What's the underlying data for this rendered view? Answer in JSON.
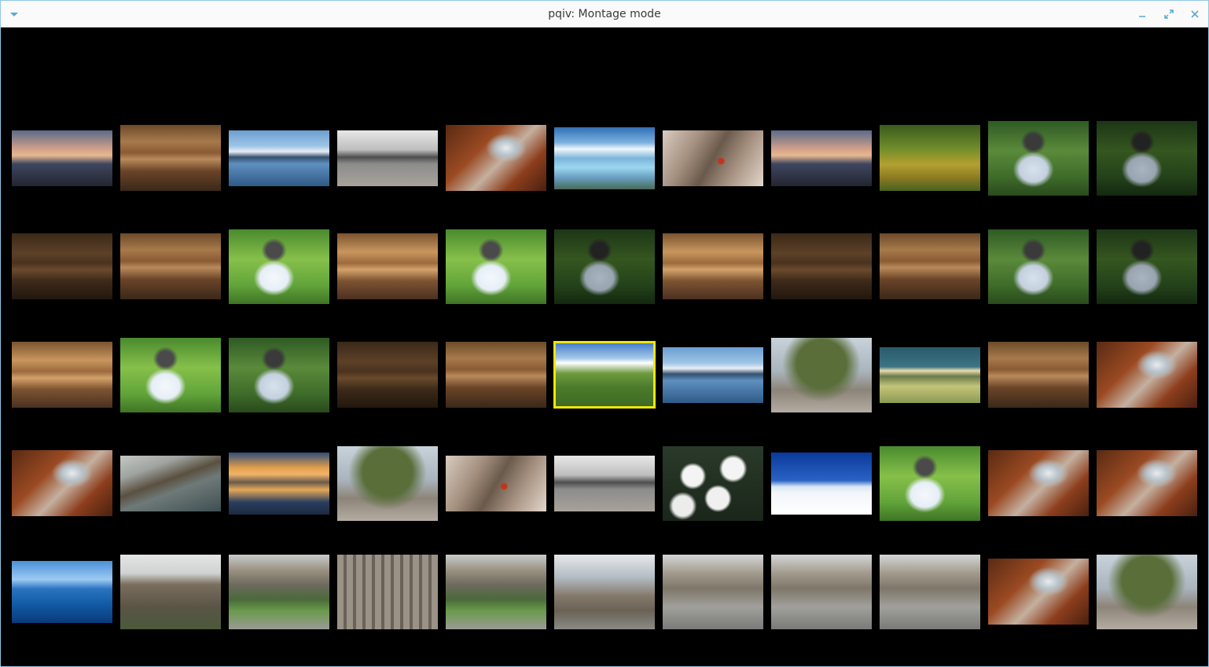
{
  "window": {
    "title": "pqiv: Montage mode",
    "icons": {
      "menu": "chevron-down-icon",
      "minimize": "minimize-icon",
      "maximize": "maximize-icon",
      "close": "close-icon"
    }
  },
  "montage": {
    "selected_index": 27,
    "selection_color": "#f1e800",
    "thumbnails": [
      {
        "subject": "sunset-lake"
      },
      {
        "subject": "autumn-reflection"
      },
      {
        "subject": "mountain-lake"
      },
      {
        "subject": "gray-beach"
      },
      {
        "subject": "waterfall"
      },
      {
        "subject": "glacier-lake"
      },
      {
        "subject": "ladybug-branch"
      },
      {
        "subject": "sunset-lake"
      },
      {
        "subject": "forest-meadow"
      },
      {
        "subject": "white-chapel"
      },
      {
        "subject": "white-chapel-dark"
      },
      {
        "subject": "autumn-reflection-dark"
      },
      {
        "subject": "autumn-reflection"
      },
      {
        "subject": "white-chapel-bright"
      },
      {
        "subject": "autumn-reflection-warm"
      },
      {
        "subject": "white-chapel-bright"
      },
      {
        "subject": "white-chapel-dark"
      },
      {
        "subject": "autumn-reflection-warm"
      },
      {
        "subject": "autumn-reflection-dark"
      },
      {
        "subject": "autumn-reflection"
      },
      {
        "subject": "white-chapel"
      },
      {
        "subject": "white-chapel-dark"
      },
      {
        "subject": "autumn-reflection-warm"
      },
      {
        "subject": "white-chapel-bright"
      },
      {
        "subject": "white-chapel"
      },
      {
        "subject": "autumn-reflection-dark"
      },
      {
        "subject": "autumn-reflection"
      },
      {
        "subject": "green-hills"
      },
      {
        "subject": "mountain-lake"
      },
      {
        "subject": "plane-tree"
      },
      {
        "subject": "farmhouse-field"
      },
      {
        "subject": "autumn-reflection"
      },
      {
        "subject": "waterfall"
      },
      {
        "subject": "waterfall"
      },
      {
        "subject": "coastline"
      },
      {
        "subject": "sunset-mountains"
      },
      {
        "subject": "plane-tree"
      },
      {
        "subject": "ladybug-branch"
      },
      {
        "subject": "gray-beach"
      },
      {
        "subject": "white-flowers"
      },
      {
        "subject": "snowy-trees"
      },
      {
        "subject": "white-chapel-bright"
      },
      {
        "subject": "waterfall"
      },
      {
        "subject": "waterfall"
      },
      {
        "subject": "ocean-sky"
      },
      {
        "subject": "library-building"
      },
      {
        "subject": "library-lawn"
      },
      {
        "subject": "library-facade"
      },
      {
        "subject": "library-lawn"
      },
      {
        "subject": "library-tower"
      },
      {
        "subject": "library-steps"
      },
      {
        "subject": "library-steps"
      },
      {
        "subject": "library-steps"
      },
      {
        "subject": "waterfall"
      },
      {
        "subject": "plane-tree"
      }
    ]
  }
}
